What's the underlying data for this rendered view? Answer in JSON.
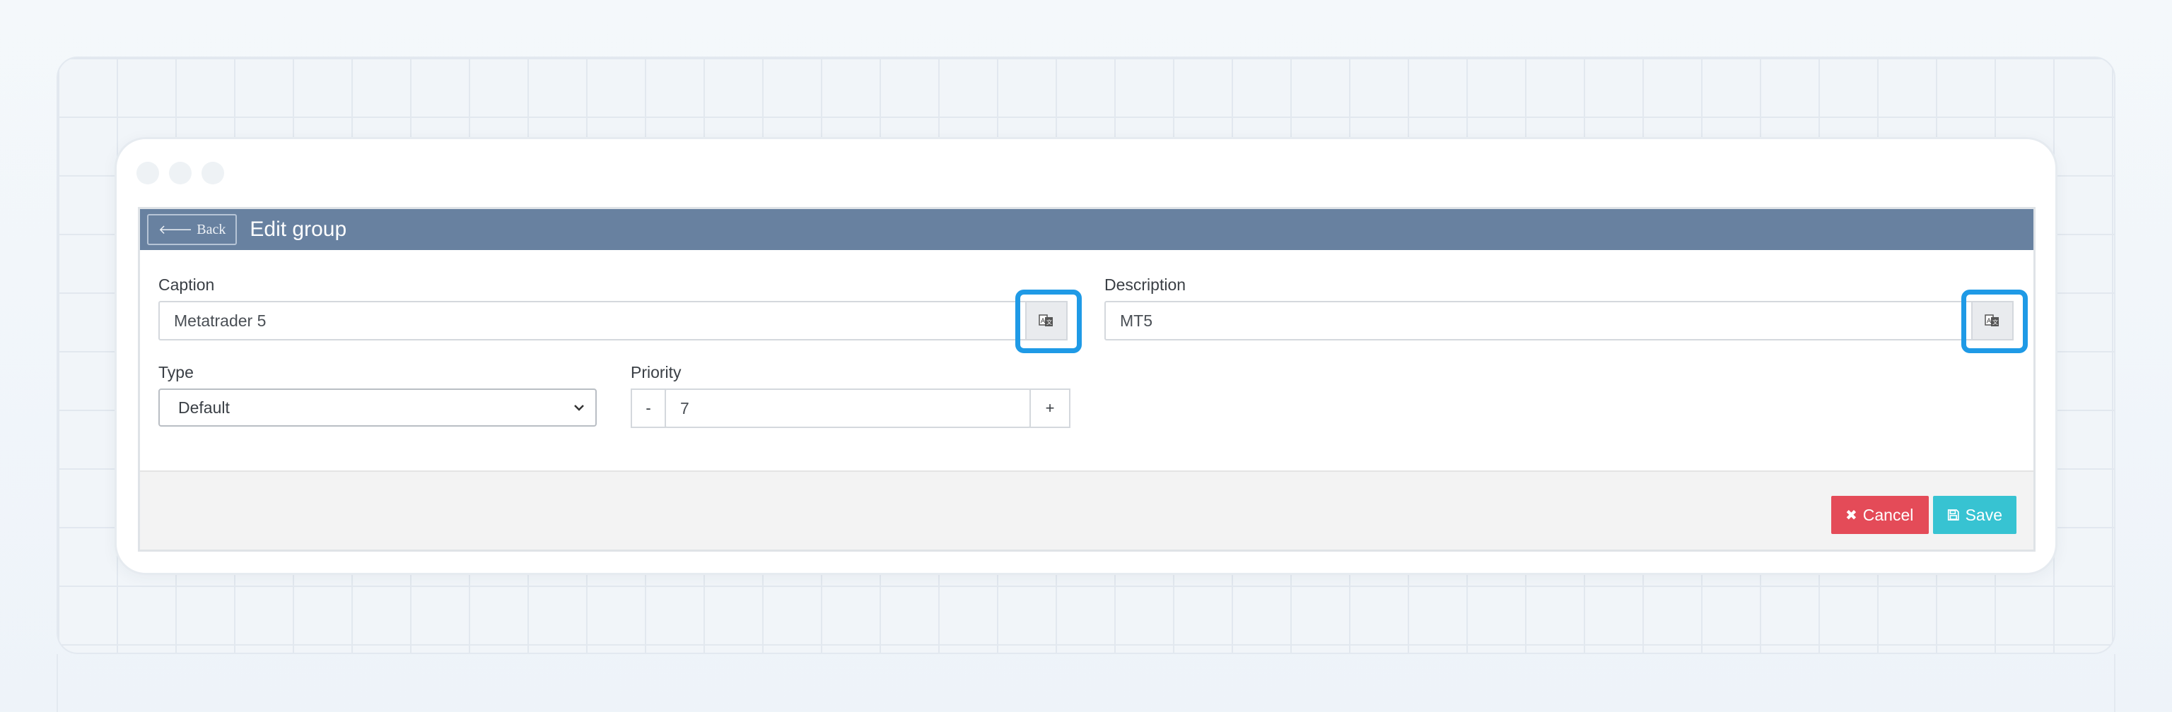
{
  "header": {
    "back_label": "Back",
    "title": "Edit group"
  },
  "form": {
    "caption": {
      "label": "Caption",
      "value": "Metatrader 5"
    },
    "description": {
      "label": "Description",
      "value": "MT5"
    },
    "type": {
      "label": "Type",
      "selected": "Default"
    },
    "priority": {
      "label": "Priority",
      "value": "7",
      "decrement": "-",
      "increment": "+"
    }
  },
  "footer": {
    "cancel_label": "Cancel",
    "save_label": "Save"
  },
  "colors": {
    "header_bg": "#6881a0",
    "cancel": "#e44b58",
    "save": "#37c3d2",
    "highlight": "#1f9ae6"
  }
}
